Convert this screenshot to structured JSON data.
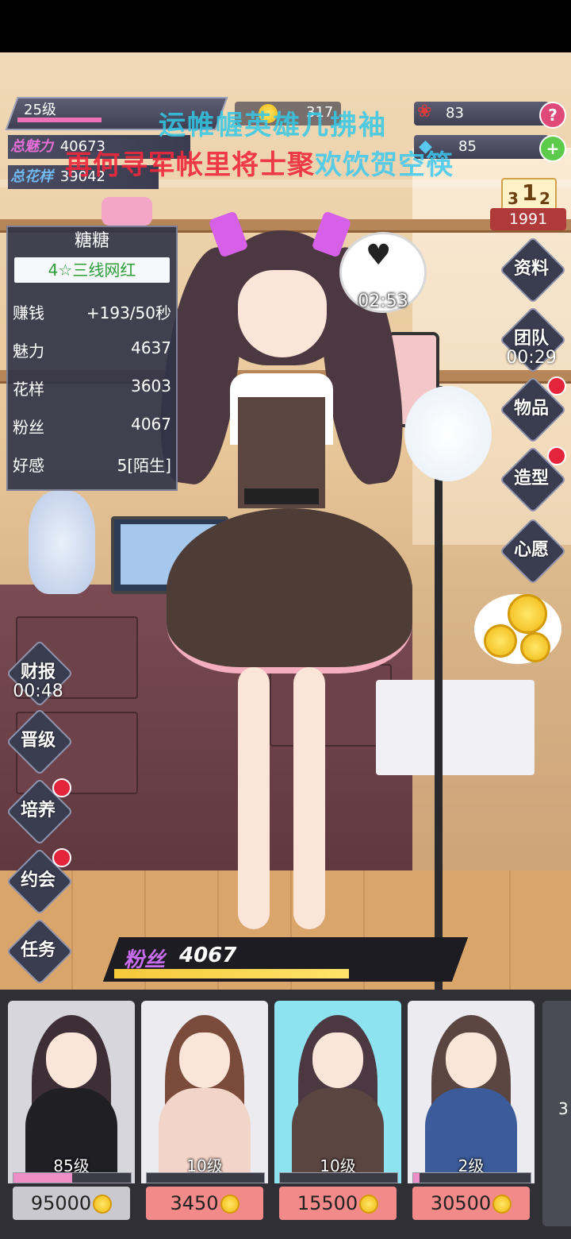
{
  "top": {
    "level": "25级",
    "level_progress": 0.4,
    "total_charm_label": "总魅力",
    "total_charm_value": "40673",
    "total_style_label": "总花样",
    "total_style_value": "39042",
    "mid_value_1": "317",
    "roses": "83",
    "diamonds": "85",
    "help": "?",
    "add": "+"
  },
  "overlay_text": {
    "line1": "运帷幄英雄几拂袖",
    "line2_red": "再何寻军帐里将士聚",
    "line2_cyan": "欢饮贺空筷"
  },
  "rank": {
    "value": "1991",
    "podium": [
      "3",
      "1",
      "2"
    ]
  },
  "card": {
    "name": "糖糖",
    "rank_title": "4☆三线网红",
    "rows": [
      {
        "k": "赚钱",
        "v": "+193/50秒"
      },
      {
        "k": "魅力",
        "v": "4637"
      },
      {
        "k": "花样",
        "v": "3603"
      },
      {
        "k": "粉丝",
        "v": "4067"
      },
      {
        "k": "好感",
        "v": "5[陌生]"
      }
    ]
  },
  "bubble_timer": "02:53",
  "right_buttons": [
    {
      "label": "资料"
    },
    {
      "label": "团队",
      "timer": "00:29"
    },
    {
      "label": "物品"
    },
    {
      "label": "造型"
    },
    {
      "label": "心愿"
    }
  ],
  "left_buttons": [
    {
      "label": "财报",
      "timer": "00:48"
    },
    {
      "label": "晋级"
    },
    {
      "label": "培养"
    },
    {
      "label": "约会"
    },
    {
      "label": "任务"
    }
  ],
  "fans": {
    "label": "粉丝",
    "value": "4067",
    "progress": 0.7
  },
  "slots": [
    {
      "level": "85级",
      "price": "95000",
      "progress": 0.5,
      "price_bg": "#c9c9cf",
      "bg": "#d6d6dc",
      "hair": "#3e2f36",
      "body": "#1f1f24"
    },
    {
      "level": "10级",
      "price": "3450",
      "progress": 0.0,
      "price_bg": "#f38a8a",
      "bg": "#ececf0",
      "hair": "#7a4a3a",
      "body": "#f2d4c8"
    },
    {
      "level": "10级",
      "price": "15500",
      "progress": 0.0,
      "price_bg": "#f38a8a",
      "bg": "#8ee3f0",
      "hair": "#4c3840",
      "body": "#5a4540"
    },
    {
      "level": "2级",
      "price": "30500",
      "progress": 0.05,
      "price_bg": "#f38a8a",
      "bg": "#ececf0",
      "hair": "#5a4540",
      "body": "#3b5b9a"
    }
  ],
  "partial_slot_text": "3"
}
